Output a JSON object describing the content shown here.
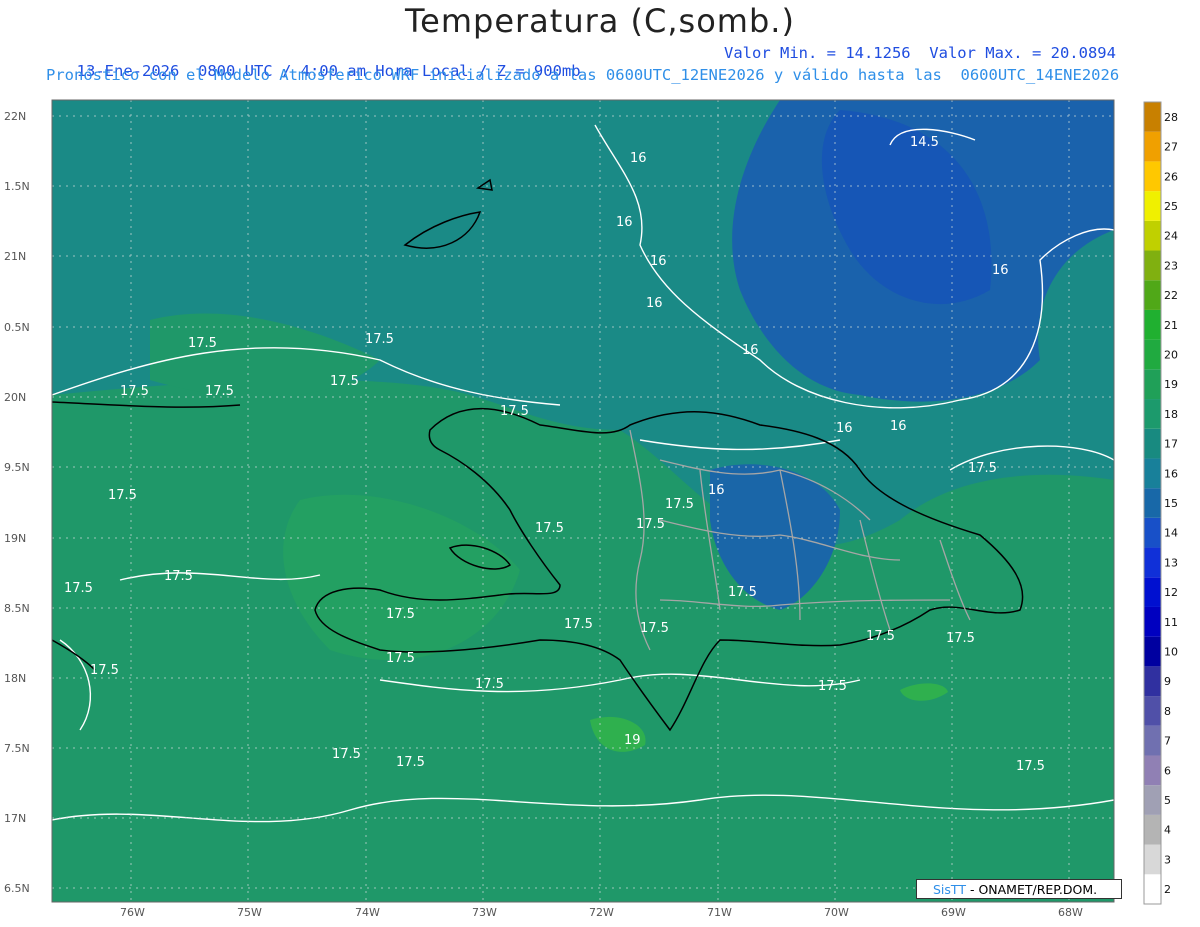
{
  "header": {
    "title": "Temperatura (C,somb.)",
    "subtitle_left": "13-Ene-2026  0800 UTC / 4:00 am Hora Local / Z = 900mb",
    "subtitle_right": "Valor Min. = 14.1256  Valor Max. = 20.0894",
    "subtitle_2": "Pronóstico con el Modelo Atmosferico WRF inicializado a las 0600UTC_12ENE2026 y válido hasta las  0600UTC_14ENE2026"
  },
  "axes": {
    "lat_ticks": [
      "22N",
      "1.5N",
      "21N",
      "0.5N",
      "20N",
      "9.5N",
      "19N",
      "8.5N",
      "18N",
      "7.5N",
      "17N",
      "6.5N"
    ],
    "lon_ticks": [
      "76W",
      "75W",
      "74W",
      "73W",
      "72W",
      "71W",
      "70W",
      "69W",
      "68W"
    ]
  },
  "colorbar": {
    "labels": [
      "2",
      "3",
      "4",
      "5",
      "6",
      "7",
      "8",
      "9",
      "10",
      "11",
      "12",
      "13",
      "14",
      "15",
      "16",
      "17",
      "18",
      "19",
      "20",
      "21",
      "22",
      "23",
      "24",
      "25",
      "26",
      "27",
      "28"
    ],
    "colors": [
      "#ffffff",
      "#d8d8d8",
      "#b4b4b4",
      "#a0a0b4",
      "#9080b4",
      "#7070b0",
      "#5050a8",
      "#3030a0",
      "#0000a0",
      "#0000c0",
      "#0010d0",
      "#1030d8",
      "#1850c8",
      "#1868a8",
      "#18809a",
      "#188a80",
      "#1c9a6c",
      "#20a058",
      "#20aa40",
      "#20b030",
      "#50a818",
      "#80b010",
      "#c0d000",
      "#f0f000",
      "#ffc800",
      "#f0a000",
      "#c88000"
    ]
  },
  "contour_labels": [
    {
      "text": "14.5"
    },
    {
      "text": "16"
    },
    {
      "text": "16"
    },
    {
      "text": "16"
    },
    {
      "text": "16"
    },
    {
      "text": "16"
    },
    {
      "text": "16"
    },
    {
      "text": "16"
    },
    {
      "text": "16"
    },
    {
      "text": "16"
    },
    {
      "text": "17.5"
    },
    {
      "text": "17.5"
    },
    {
      "text": "17.5"
    },
    {
      "text": "17.5"
    },
    {
      "text": "17.5"
    },
    {
      "text": "17.5"
    },
    {
      "text": "17.5"
    },
    {
      "text": "17.5"
    },
    {
      "text": "17.5"
    },
    {
      "text": "17.5"
    },
    {
      "text": "17.5"
    },
    {
      "text": "17.5"
    },
    {
      "text": "17.5"
    },
    {
      "text": "17.5"
    },
    {
      "text": "17.5"
    },
    {
      "text": "17.5"
    },
    {
      "text": "17.5"
    },
    {
      "text": "17.5"
    },
    {
      "text": "17.5"
    },
    {
      "text": "17.5"
    },
    {
      "text": "17.5"
    },
    {
      "text": "17.5"
    },
    {
      "text": "17.5"
    },
    {
      "text": "17.5"
    },
    {
      "text": "17.5"
    },
    {
      "text": "17.5"
    },
    {
      "text": "19"
    }
  ],
  "credit": {
    "brand": "SisTT",
    "text": " - ONAMET/REP.DOM."
  }
}
